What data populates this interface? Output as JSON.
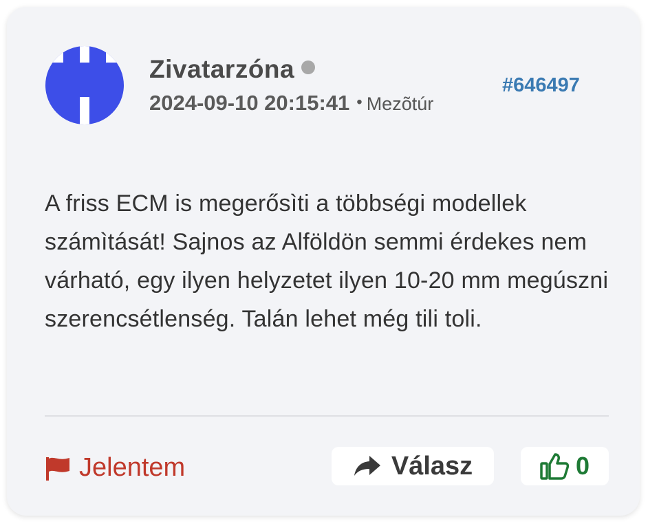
{
  "post": {
    "author": "Zivatarzóna",
    "timestamp": "2024-09-10 20:15:41",
    "separator": "•",
    "location": "Mezõtúr",
    "post_id": "#646497",
    "body": "A friss ECM is megerősìti a többségi modellek számìtását! Sajnos az Alföldön semmi érdekes nem várható, egy ilyen helyzetet ilyen 10-20 mm megúszni szerencsétlenség. Talán lehet még tili toli."
  },
  "actions": {
    "report_label": "Jelentem",
    "reply_label": "Válasz",
    "like_count": "0"
  },
  "colors": {
    "avatar": "#3d4ee8",
    "post_id": "#3a7ab2",
    "report": "#c0392b",
    "like": "#1e7a35",
    "status_dot": "#a8a8a8"
  },
  "icons": {
    "avatar": "avatar-pattern-icon",
    "status": "offline-status-dot",
    "report": "flag-icon",
    "reply": "share-arrow-icon",
    "like": "thumbs-up-icon"
  }
}
